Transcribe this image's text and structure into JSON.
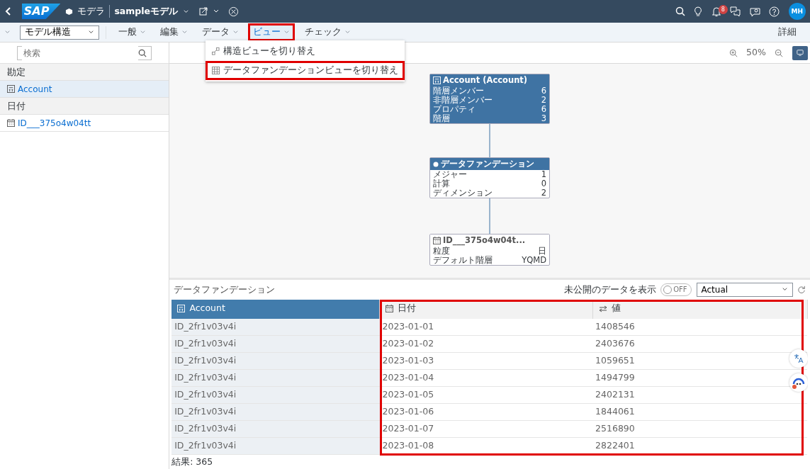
{
  "topbar": {
    "logo": "SAP",
    "app": "モデラ",
    "model": "sampleモデル",
    "notification_count": "8",
    "avatar": "MH"
  },
  "toolbar": {
    "view_select": "モデル構造",
    "menus": [
      {
        "label": "一般",
        "selected": false,
        "highlighted": false
      },
      {
        "label": "編集",
        "selected": false,
        "highlighted": false
      },
      {
        "label": "データ",
        "selected": false,
        "highlighted": false
      },
      {
        "label": "ビュー",
        "selected": true,
        "highlighted": true
      },
      {
        "label": "チェック",
        "selected": false,
        "highlighted": false
      }
    ],
    "details": "詳細"
  },
  "view_menu": [
    {
      "label": "構造ビューを切り替え",
      "kind": "structure",
      "highlighted": false
    },
    {
      "label": "データファンデーションビューを切り替え",
      "kind": "grid",
      "highlighted": true
    }
  ],
  "sidebar": {
    "search_placeholder": "検索",
    "groups": [
      {
        "label": "勘定",
        "items": [
          {
            "label": "Account",
            "kind": "account",
            "selected": true
          }
        ]
      },
      {
        "label": "日付",
        "items": [
          {
            "label": "ID___375o4w04tt",
            "kind": "date",
            "selected": false
          }
        ]
      }
    ]
  },
  "canvas": {
    "zoom": "50%",
    "nodes": [
      {
        "title": "Account (Account)",
        "kind": "account",
        "rows": [
          [
            "階層メンバー",
            "6"
          ],
          [
            "非階層メンバー",
            "2"
          ],
          [
            "プロパティ",
            "6"
          ],
          [
            "階層",
            "3"
          ]
        ]
      },
      {
        "title": "データファンデーション",
        "kind": "foundation",
        "rows": [
          [
            "メジャー",
            "1"
          ],
          [
            "計算",
            "0"
          ],
          [
            "ディメンション",
            "2"
          ]
        ]
      },
      {
        "title": "ID___375o4w04t...",
        "kind": "date",
        "rows": [
          [
            "粒度",
            "日"
          ],
          [
            "デフォルト階層",
            "YQMD"
          ]
        ]
      }
    ]
  },
  "data_foundation": {
    "title": "データファンデーション",
    "unpublished_label": "未公開のデータを表示",
    "unpublished_on": false,
    "toggle_text": "OFF",
    "version": "Actual",
    "columns": [
      {
        "label": "Account",
        "kind": "account",
        "selected": true
      },
      {
        "label": "日付",
        "kind": "date",
        "selected": false,
        "highlighted": true
      },
      {
        "label": "値",
        "kind": "measure",
        "selected": false,
        "highlighted": true
      }
    ],
    "rows": [
      [
        "ID_2fr1v03v4i",
        "2023-01-01",
        "1408546"
      ],
      [
        "ID_2fr1v03v4i",
        "2023-01-02",
        "2403676"
      ],
      [
        "ID_2fr1v03v4i",
        "2023-01-03",
        "1059651"
      ],
      [
        "ID_2fr1v03v4i",
        "2023-01-04",
        "1494799"
      ],
      [
        "ID_2fr1v03v4i",
        "2023-01-05",
        "2402131"
      ],
      [
        "ID_2fr1v03v4i",
        "2023-01-06",
        "1844061"
      ],
      [
        "ID_2fr1v03v4i",
        "2023-01-07",
        "2516890"
      ],
      [
        "ID_2fr1v03v4i",
        "2023-01-08",
        "2822401"
      ]
    ],
    "result": "結果: 365"
  }
}
